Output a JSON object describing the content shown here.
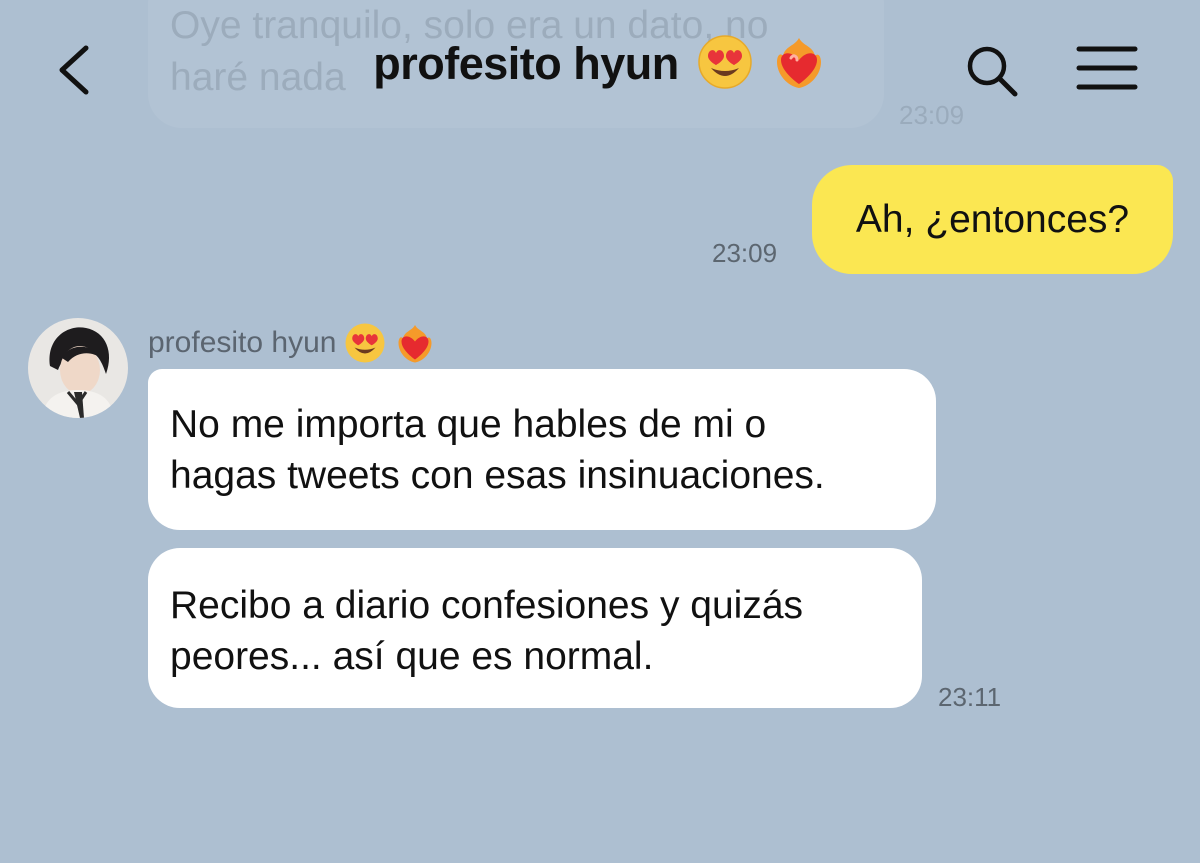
{
  "header": {
    "title": "profesito hyun",
    "title_emojis": [
      "heart-eyes-emoji",
      "heart-on-fire-emoji"
    ],
    "back_icon": "chevron-left-icon",
    "search_icon": "search-icon",
    "menu_icon": "hamburger-menu-icon"
  },
  "faded_message": {
    "text": "Oye tranquilo, solo era un dato, no\nharé nada",
    "time": "23:09"
  },
  "outgoing": {
    "text": "Ah, ¿entonces?",
    "time": "23:09",
    "color": "#fbe752"
  },
  "incoming": {
    "sender_name": "profesito hyun",
    "messages": [
      {
        "lines": [
          "No me importa que hables de mi o",
          "hagas tweets con esas insinuaciones."
        ]
      },
      {
        "lines": [
          "Recibo a diario confesiones y quizás",
          "peores... así que es normal."
        ]
      }
    ],
    "time": "23:11",
    "color": "#ffffff"
  },
  "colors": {
    "background": "#adbfd1",
    "outgoing_bubble": "#fbe752",
    "incoming_bubble": "#ffffff",
    "timestamp": "#5c6670"
  }
}
